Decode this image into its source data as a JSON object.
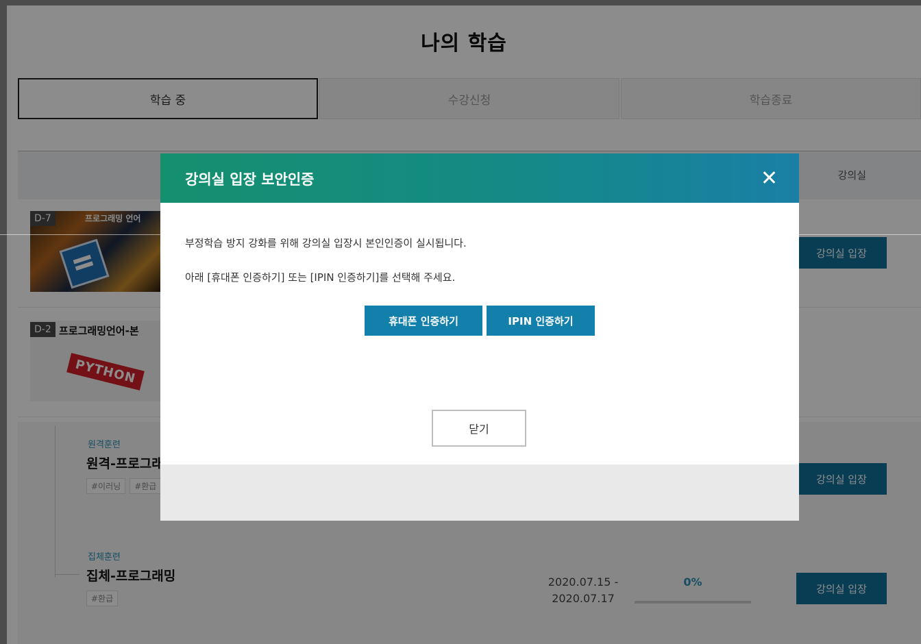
{
  "page": {
    "title": "나의 학습",
    "tabs": [
      {
        "label": "학습 중",
        "active": true
      },
      {
        "label": "수강신청",
        "active": false
      },
      {
        "label": "학습종료",
        "active": false
      }
    ],
    "table_header": {
      "classroom": "강의실"
    }
  },
  "courses": [
    {
      "d_day": "D-7",
      "title": "프로그래밍 언어",
      "enter_label": "강의실 입장"
    },
    {
      "d_day": "D-2",
      "title": "프로그래밍언어-본",
      "banner": "PYTHON"
    }
  ],
  "sub_courses": [
    {
      "category": "원격훈련",
      "title": "원격-프로그래",
      "tags": [
        "#이러닝",
        "#환급"
      ],
      "enter_label": "강의실 입장"
    },
    {
      "category": "집체훈련",
      "title": "집체-프로그래밍",
      "tags": [
        "#환급"
      ],
      "date_start": "2020.07.15 -",
      "date_end": "2020.07.17",
      "progress_label": "0%",
      "progress_value": 0,
      "enter_label": "강의실 입장"
    }
  ],
  "modal": {
    "title": "강의실 입장 보안인증",
    "message1": "부정학습 방지 강화를 위해 강의실 입장시 본인인증이 실시됩니다.",
    "message2": "아래 [휴대폰 인증하기] 또는 [IPIN 인증하기]를 선택해 주세요.",
    "phone_button": "휴대폰 인증하기",
    "ipin_button": "IPIN 인증하기",
    "close_button": "닫기"
  },
  "colors": {
    "modal_header": "#138a86",
    "primary_button": "#1380ab",
    "overlay": "rgba(0,0,0,0.45)"
  }
}
